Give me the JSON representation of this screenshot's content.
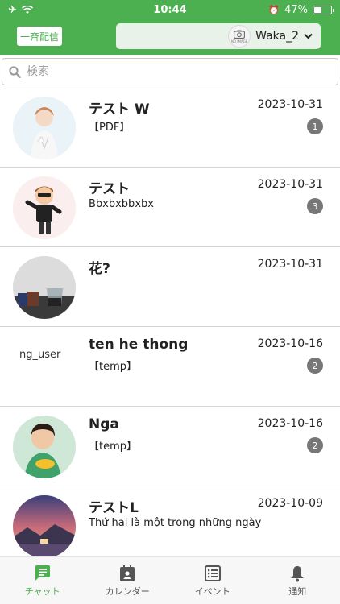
{
  "status_bar": {
    "time": "10:44",
    "battery": "47%",
    "battery_level": 0.47
  },
  "header": {
    "broadcast_label": "一斉配信",
    "account_name": "Waka_2",
    "no_image_label": "NO IMAGE",
    "accent_color": "#4caf50"
  },
  "search": {
    "placeholder": "検索"
  },
  "chats": [
    {
      "name": "テスト W",
      "date": "2023-10-31",
      "preview": "【PDF】",
      "unread": "1"
    },
    {
      "name": "テスト",
      "date": "2023-10-31",
      "preview": "Bbxbxbbxbx",
      "unread": "3"
    },
    {
      "name": "花?",
      "date": "2023-10-31",
      "preview": "",
      "unread": ""
    },
    {
      "name": "ten he thong",
      "date": "2023-10-16",
      "preview": "【temp】",
      "unread": "2",
      "avatar_alt": "ng_user"
    },
    {
      "name": "Nga",
      "date": "2023-10-16",
      "preview": "【temp】",
      "unread": "2"
    },
    {
      "name": "テストL",
      "date": "2023-10-09",
      "preview": "Thứ hai là một trong những ngày",
      "unread": ""
    }
  ],
  "tabs": [
    {
      "label": "チャット",
      "icon": "chat-icon",
      "active": true
    },
    {
      "label": "カレンダー",
      "icon": "calendar-icon",
      "active": false
    },
    {
      "label": "イベント",
      "icon": "event-list-icon",
      "active": false
    },
    {
      "label": "通知",
      "icon": "bell-icon",
      "active": false
    }
  ]
}
